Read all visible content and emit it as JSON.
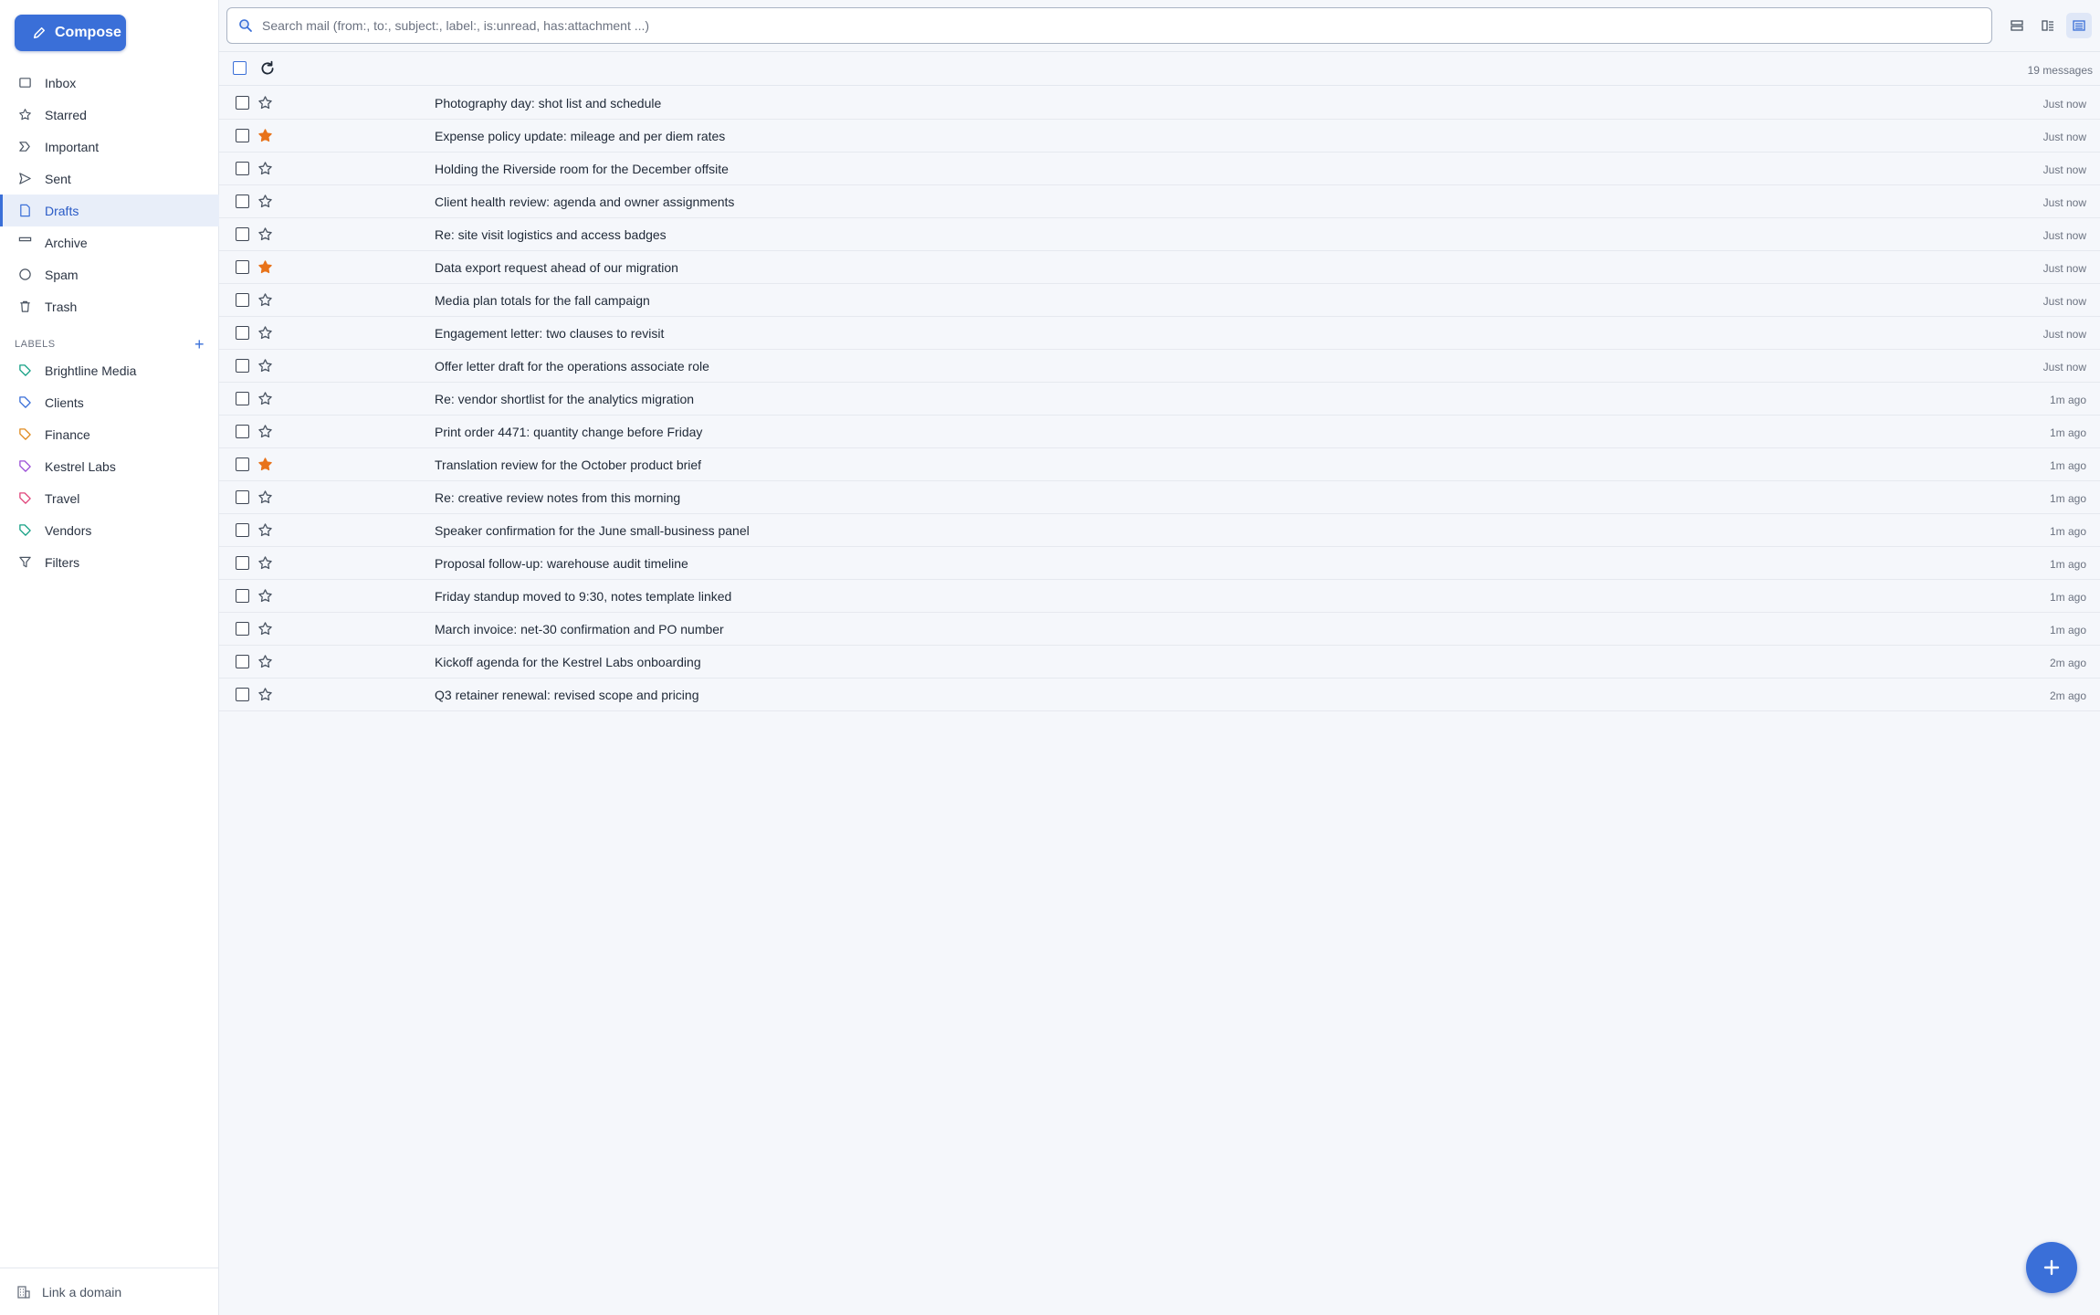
{
  "compose_label": "Compose",
  "nav": [
    {
      "label": "Inbox",
      "icon": "inbox-icon"
    },
    {
      "label": "Starred",
      "icon": "star-icon"
    },
    {
      "label": "Important",
      "icon": "important-icon"
    },
    {
      "label": "Sent",
      "icon": "send-icon"
    },
    {
      "label": "Drafts",
      "icon": "draft-icon",
      "active": true
    },
    {
      "label": "Archive",
      "icon": "archive-icon"
    },
    {
      "label": "Spam",
      "icon": "spam-icon"
    },
    {
      "label": "Trash",
      "icon": "trash-icon"
    }
  ],
  "labels_heading": "LABELS",
  "labels_add": "+",
  "labels": [
    {
      "label": "Brightline Media",
      "color": "#16a085"
    },
    {
      "label": "Clients",
      "color": "#3a6fd8"
    },
    {
      "label": "Finance",
      "color": "#e08a1e"
    },
    {
      "label": "Kestrel Labs",
      "color": "#9b4fd6"
    },
    {
      "label": "Travel",
      "color": "#e0457b"
    },
    {
      "label": "Vendors",
      "color": "#16a085"
    }
  ],
  "filters_label": "Filters",
  "footer_label": "Link a domain",
  "search_placeholder": "Search mail (from:, to:, subject:, label:, is:unread, has:attachment ...)",
  "message_count": "19 messages",
  "accent_color": "#3a6fd8",
  "star_color": "#e8731a",
  "messages": [
    {
      "subject": "Photography day: shot list and schedule",
      "time": "Just now",
      "starred": false
    },
    {
      "subject": "Expense policy update: mileage and per diem rates",
      "time": "Just now",
      "starred": true
    },
    {
      "subject": "Holding the Riverside room for the December offsite",
      "time": "Just now",
      "starred": false
    },
    {
      "subject": "Client health review: agenda and owner assignments",
      "time": "Just now",
      "starred": false
    },
    {
      "subject": "Re: site visit logistics and access badges",
      "time": "Just now",
      "starred": false
    },
    {
      "subject": "Data export request ahead of our migration",
      "time": "Just now",
      "starred": true
    },
    {
      "subject": "Media plan totals for the fall campaign",
      "time": "Just now",
      "starred": false
    },
    {
      "subject": "Engagement letter: two clauses to revisit",
      "time": "Just now",
      "starred": false
    },
    {
      "subject": "Offer letter draft for the operations associate role",
      "time": "Just now",
      "starred": false
    },
    {
      "subject": "Re: vendor shortlist for the analytics migration",
      "time": "1m ago",
      "starred": false
    },
    {
      "subject": "Print order 4471: quantity change before Friday",
      "time": "1m ago",
      "starred": false
    },
    {
      "subject": "Translation review for the October product brief",
      "time": "1m ago",
      "starred": true
    },
    {
      "subject": "Re: creative review notes from this morning",
      "time": "1m ago",
      "starred": false
    },
    {
      "subject": "Speaker confirmation for the June small-business panel",
      "time": "1m ago",
      "starred": false
    },
    {
      "subject": "Proposal follow-up: warehouse audit timeline",
      "time": "1m ago",
      "starred": false
    },
    {
      "subject": "Friday standup moved to 9:30, notes template linked",
      "time": "1m ago",
      "starred": false
    },
    {
      "subject": "March invoice: net-30 confirmation and PO number",
      "time": "1m ago",
      "starred": false
    },
    {
      "subject": "Kickoff agenda for the Kestrel Labs onboarding",
      "time": "2m ago",
      "starred": false
    },
    {
      "subject": "Q3 retainer renewal: revised scope and pricing",
      "time": "2m ago",
      "starred": false
    }
  ]
}
